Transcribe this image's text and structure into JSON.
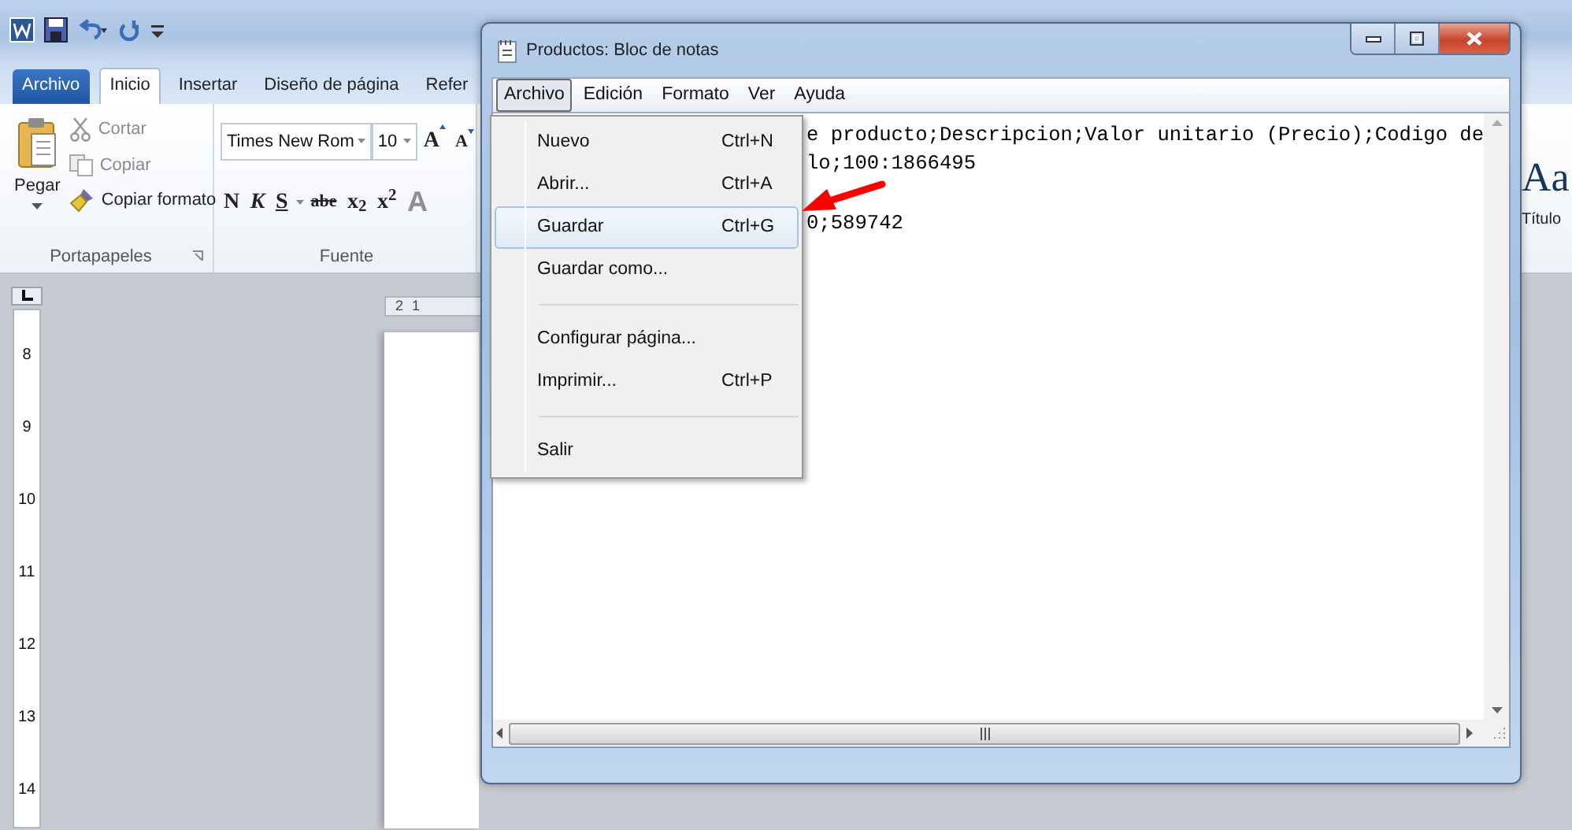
{
  "word": {
    "tabs": [
      {
        "label": "Archivo",
        "kind": "file",
        "selected": false
      },
      {
        "label": "Inicio",
        "kind": "tab",
        "selected": true
      },
      {
        "label": "Insertar",
        "kind": "tab",
        "selected": false
      },
      {
        "label": "Diseño de página",
        "kind": "tab",
        "selected": false
      },
      {
        "label": "Refer",
        "kind": "tab",
        "selected": false
      }
    ],
    "clipboard": {
      "paste": "Pegar",
      "cut": "Cortar",
      "copy": "Copiar",
      "format_painter": "Copiar formato",
      "group_label": "Portapapeles"
    },
    "font": {
      "name": "Times New Rom",
      "size": "10",
      "grow": "A",
      "shrink": "A",
      "bold": "N",
      "italic": "K",
      "underline": "S",
      "strike": "abe",
      "subscript": "x$_{2}$",
      "superscript": "x$^{2}$",
      "effects": "A",
      "group_label": "Fuente"
    },
    "styles": {
      "preview": "Aa",
      "label": "Título"
    },
    "horizontal_ruler": [
      "2",
      "1"
    ],
    "vertical_ruler": [
      "8",
      "9",
      "10",
      "11",
      "12",
      "13",
      "14"
    ]
  },
  "notepad": {
    "title": "Productos: Bloc de notas",
    "menu": [
      {
        "label": "Archivo",
        "selected": true
      },
      {
        "label": "Edición",
        "selected": false
      },
      {
        "label": "Formato",
        "selected": false
      },
      {
        "label": "Ver",
        "selected": false
      },
      {
        "label": "Ayuda",
        "selected": false
      }
    ],
    "lines": [
      "e producto;Descripcion;Valor unitario (Precio);Codigo de",
      "lo;100:1866495",
      "0;589742"
    ],
    "file_menu": [
      {
        "kind": "item",
        "label": "Nuevo",
        "shortcut": "Ctrl+N",
        "selected": false
      },
      {
        "kind": "item",
        "label": "Abrir...",
        "shortcut": "Ctrl+A",
        "selected": false
      },
      {
        "kind": "item",
        "label": "Guardar",
        "shortcut": "Ctrl+G",
        "selected": true
      },
      {
        "kind": "item",
        "label": "Guardar como...",
        "selected": false
      },
      {
        "kind": "separator"
      },
      {
        "kind": "item",
        "label": "Configurar página...",
        "selected": false
      },
      {
        "kind": "item",
        "label": "Imprimir...",
        "shortcut": "Ctrl+P",
        "selected": false
      },
      {
        "kind": "separator"
      },
      {
        "kind": "item",
        "label": "Salir",
        "selected": false
      }
    ]
  }
}
